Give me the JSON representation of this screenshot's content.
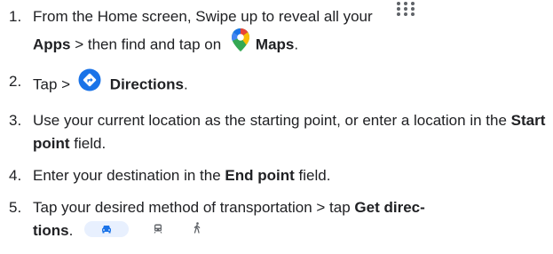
{
  "steps": [
    {
      "num": "1.",
      "text_a": "From the Home screen, Swipe up to reveal all your",
      "apps": "Apps",
      "text_b": " > then find and tap on",
      "maps": "Maps",
      "end": ".",
      "icons": [
        "apps-grid-icon",
        "google-maps-icon"
      ]
    },
    {
      "num": "2.",
      "text_a": "Tap >",
      "directions": "Directions",
      "end": ".",
      "icons": [
        "directions-icon"
      ]
    },
    {
      "num": "3.",
      "text_a": "Use your current location as the starting point, or enter a location in the ",
      "start_point": "Start point",
      "text_b": " field."
    },
    {
      "num": "4.",
      "text_a": "Enter your destination in the ",
      "end_point": "End point",
      "text_b": " field."
    },
    {
      "num": "5.",
      "text_a": "Tap your desired method of transportation > tap ",
      "get_directions_1": "Get direc-",
      "get_directions_2": "tions",
      "end": ".",
      "icons": [
        "car-icon",
        "transit-icon",
        "walk-icon"
      ]
    }
  ],
  "colors": {
    "text": "#202124",
    "maps_red": "#ea4335",
    "maps_yellow": "#fbbc04",
    "maps_green": "#34a853",
    "maps_blue": "#4285f4",
    "directions_blue": "#1a73e8",
    "mode_selected_bg": "#e8f0fe",
    "mode_selected_icon": "#1a73e8",
    "mode_icon": "#5f6368",
    "dots": "#5f6368"
  }
}
